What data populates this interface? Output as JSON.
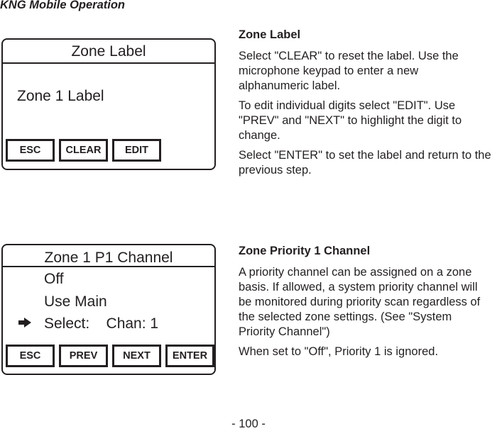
{
  "header": {
    "title": "KNG Mobile Operation"
  },
  "screens": [
    {
      "title": "Zone Label",
      "value": "Zone 1 Label",
      "softkeys": [
        "ESC",
        "CLEAR",
        "EDIT"
      ]
    },
    {
      "title": "Zone 1 P1 Channel",
      "options": [
        "Off",
        "Use Main",
        "Select:    Chan: 1"
      ],
      "selected_index": 2,
      "selector_icon": "right-arrow",
      "softkeys": [
        "ESC",
        "PREV",
        "NEXT",
        "ENTER"
      ]
    }
  ],
  "sections": [
    {
      "heading": "Zone Label",
      "paragraphs": [
        "Select \"CLEAR\" to reset the label. Use the microphone keypad to enter a new alphanumeric label.",
        "To edit individual digits select \"EDIT\". Use \"PREV\" and \"NEXT\" to highlight the digit to change.",
        "Select \"ENTER\" to set the label and return to the previous step."
      ]
    },
    {
      "heading": "Zone Priority 1 Channel",
      "paragraphs": [
        "A priority channel can be assigned  on a zone basis. If allowed, a system priority channel will be monitored during priority scan regardless of the selected zone settings. (See \"System Priority Channel\")",
        "When set to \"Off\", Priority 1 is ignored."
      ]
    }
  ],
  "footer": {
    "page_number": "- 100 -"
  }
}
